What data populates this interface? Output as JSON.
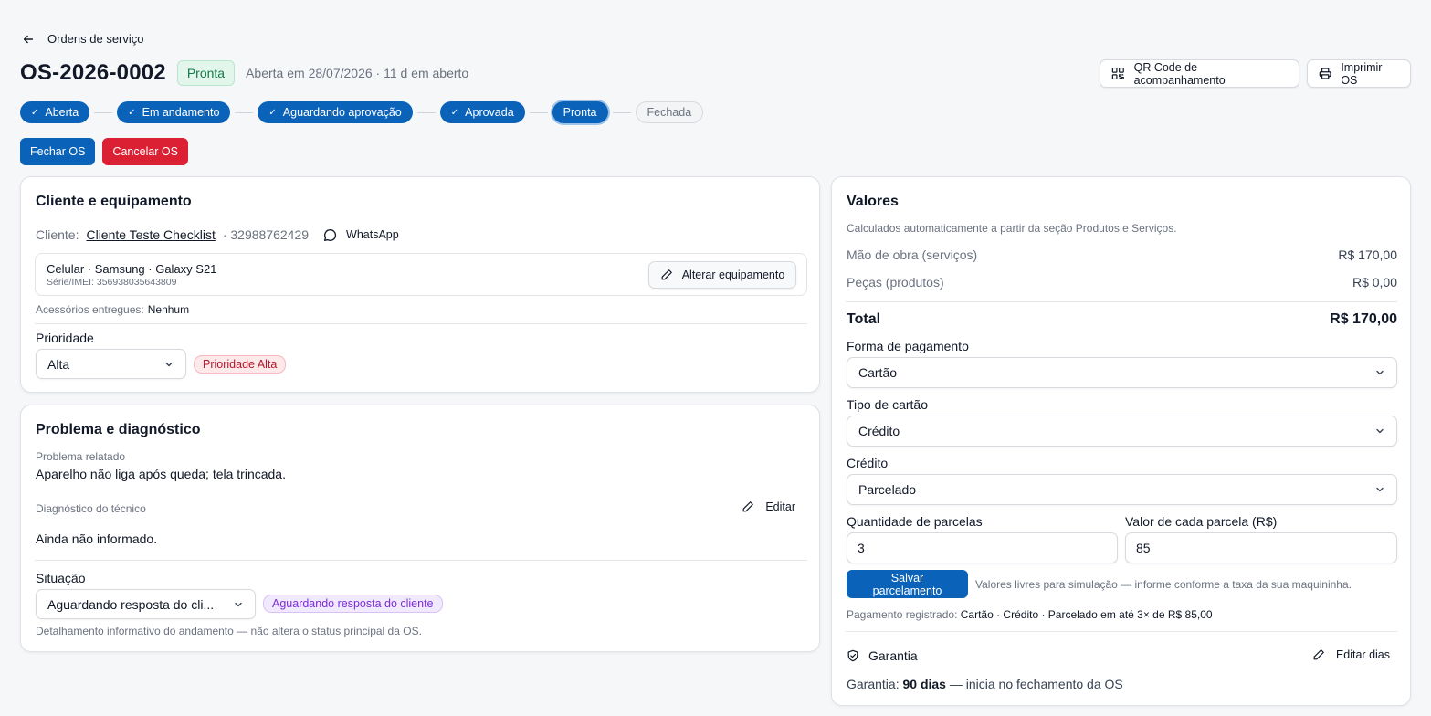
{
  "header": {
    "back_label": "Ordens de serviço",
    "os_id": "OS-2026-0002",
    "status_badge": "Pronta",
    "opened_info": "Aberta em 28/07/2026 · 11 d em aberto",
    "qr_button": "QR Code de acompanhamento",
    "print_button": "Imprimir OS"
  },
  "stepper": {
    "steps": [
      {
        "label": "Aberta",
        "state": "done"
      },
      {
        "label": "Em andamento",
        "state": "done"
      },
      {
        "label": "Aguardando aprovação",
        "state": "done"
      },
      {
        "label": "Aprovada",
        "state": "done"
      },
      {
        "label": "Pronta",
        "state": "current"
      },
      {
        "label": "Fechada",
        "state": "todo"
      }
    ]
  },
  "actions": {
    "close_label": "Fechar OS",
    "cancel_label": "Cancelar OS"
  },
  "client_card": {
    "title": "Cliente e equipamento",
    "client_label": "Cliente:",
    "client_name": "Cliente Teste Checklist",
    "client_phone": "· 32988762429",
    "whatsapp_label": "WhatsApp",
    "equipment_name": "Celular · Samsung · Galaxy S21",
    "equipment_serial": "Série/IMEI: 356938035643809",
    "change_equipment_label": "Alterar equipamento",
    "accessories_label": "Acessórios entregues:",
    "accessories_value": "Nenhum",
    "priority_label": "Prioridade",
    "priority_value": "Alta",
    "priority_badge": "Prioridade Alta"
  },
  "problem_card": {
    "title": "Problema e diagnóstico",
    "reported_label": "Problema relatado",
    "reported_value": "Aparelho não liga após queda; tela trincada.",
    "diagnosis_label": "Diagnóstico do técnico",
    "edit_label": "Editar",
    "diagnosis_value": "Ainda não informado.",
    "situation_label": "Situação",
    "situation_value": "Aguardando resposta do cli...",
    "situation_badge": "Aguardando resposta do cliente",
    "situation_note": "Detalhamento informativo do andamento — não altera o status principal da OS."
  },
  "values_card": {
    "title": "Valores",
    "subtitle": "Calculados automaticamente a partir da seção Produtos e Serviços.",
    "labor_label": "Mão de obra (serviços)",
    "labor_value": "R$ 170,00",
    "parts_label": "Peças (produtos)",
    "parts_value": "R$ 0,00",
    "total_label": "Total",
    "total_value": "R$ 170,00",
    "payment_label": "Forma de pagamento",
    "payment_value": "Cartão",
    "card_type_label": "Tipo de cartão",
    "card_type_value": "Crédito",
    "credit_label": "Crédito",
    "credit_value": "Parcelado",
    "installments_label": "Quantidade de parcelas",
    "installments_value": "3",
    "installment_value_label": "Valor de cada parcela (R$)",
    "installment_value": "85",
    "save_button": "Salvar parcelamento",
    "save_hint": "Valores livres para simulação — informe conforme a taxa da sua maquininha.",
    "registered_label": "Pagamento registrado:",
    "registered_value": "Cartão · Crédito · Parcelado em até 3× de R$ 85,00",
    "warranty_title": "Garantia",
    "warranty_edit": "Editar dias",
    "warranty_prefix": "Garantia:",
    "warranty_days": "90 dias",
    "warranty_suffix": "— inicia no fechamento da OS"
  },
  "colors": {
    "primary": "#0a63b8",
    "danger": "#dc2034",
    "success_bg": "#e3f6ec",
    "success_text": "#16794a"
  }
}
